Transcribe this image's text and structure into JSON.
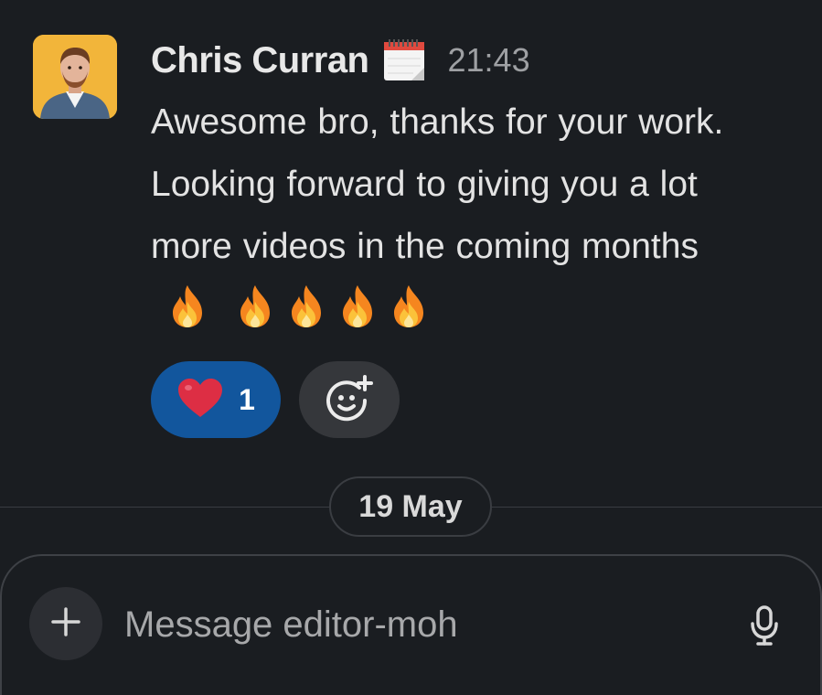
{
  "message": {
    "author": "Chris Curran",
    "status_icon": "calendar-icon",
    "timestamp": "21:43",
    "text": "Awesome bro, thanks for your work. Looking forward to giving you a lot more videos in the coming months",
    "trailing_emoji": [
      "fire",
      "fire",
      "fire",
      "fire",
      "fire"
    ]
  },
  "reactions": [
    {
      "emoji": "heart-icon",
      "count": "1",
      "active": true
    }
  ],
  "add_reaction_icon": "add-emoji-icon",
  "date_divider": "19 May",
  "composer": {
    "placeholder": "Message editor-moh",
    "value": "",
    "plus_icon": "plus-icon",
    "mic_icon": "microphone-icon"
  },
  "colors": {
    "background": "#1a1d21",
    "reaction_active": "#12569d",
    "avatar_bg": "#f2b53a"
  }
}
